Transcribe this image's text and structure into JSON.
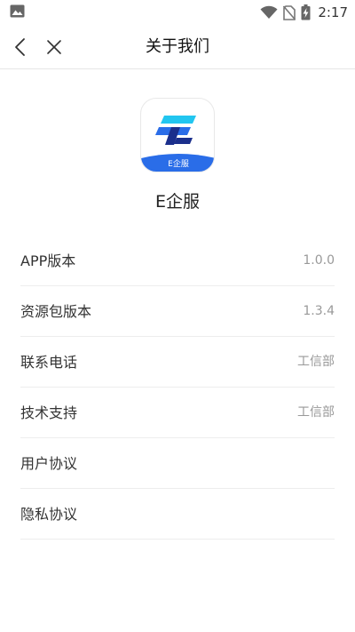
{
  "status_bar": {
    "time": "2:17",
    "icons": [
      "image-icon",
      "wifi-icon",
      "no-sim-icon",
      "battery-charging-icon"
    ]
  },
  "header": {
    "title": "关于我们",
    "back_icon": "chevron-left-icon",
    "close_icon": "close-icon"
  },
  "app": {
    "icon_label": "E企服",
    "name": "E企服",
    "colors": {
      "accent_blue": "#2a6de8",
      "cyan": "#22c6f0",
      "navy": "#1b2f8c"
    }
  },
  "items": [
    {
      "label": "APP版本",
      "value": "1.0.0"
    },
    {
      "label": "资源包版本",
      "value": "1.3.4"
    },
    {
      "label": "联系电话",
      "value": "工信部"
    },
    {
      "label": "技术支持",
      "value": "工信部"
    },
    {
      "label": "用户协议",
      "value": ""
    },
    {
      "label": "隐私协议",
      "value": ""
    }
  ]
}
